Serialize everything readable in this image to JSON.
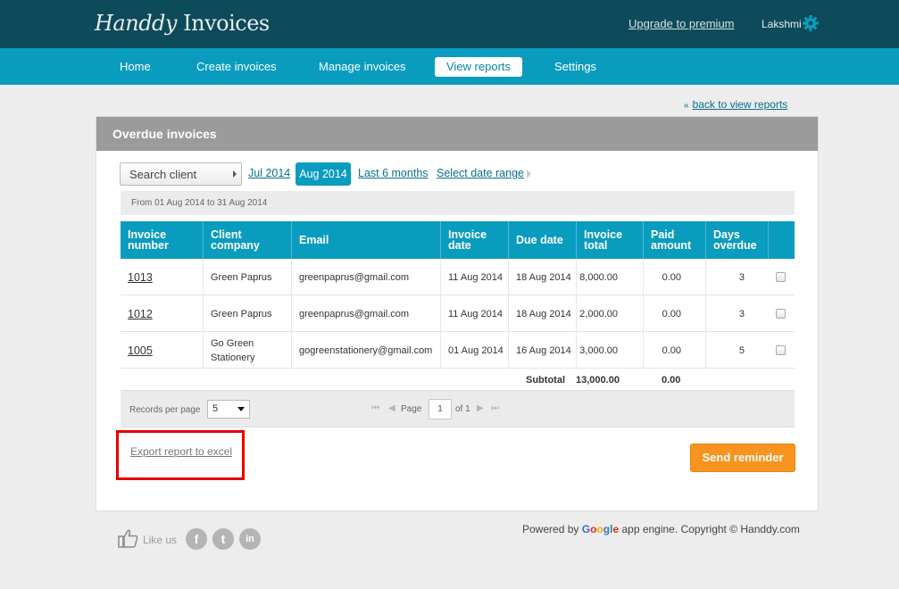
{
  "header": {
    "logo_part1": "Handdy",
    "logo_part2": "Invoices",
    "upgrade_link": "Upgrade to premium",
    "username": "Lakshmi"
  },
  "nav": {
    "items": [
      "Home",
      "Create invoices",
      "Manage invoices",
      "View reports",
      "Settings"
    ],
    "active": "View reports"
  },
  "back_link": "back to view reports",
  "panel": {
    "title": "Overdue invoices",
    "search_client": "Search client",
    "filters": {
      "jul": "Jul 2014",
      "aug": "Aug 2014",
      "last6": "Last 6 months",
      "range": "Select date range"
    },
    "date_range_text": "From 01 Aug 2014 to 31 Aug 2014"
  },
  "table": {
    "headers": {
      "invoice_number": "Invoice number",
      "client_company": "Client company",
      "email": "Email",
      "invoice_date": "Invoice date",
      "due_date": "Due date",
      "invoice_total": "Invoice total",
      "paid_amount": "Paid amount",
      "days_overdue": "Days overdue"
    },
    "rows": [
      {
        "number": "1013",
        "client": "Green Paprus",
        "email": "greenpaprus@gmail.com",
        "invoice_date": "11 Aug 2014",
        "due_date": "18 Aug 2014",
        "total": "8,000.00",
        "paid": "0.00",
        "days": "3"
      },
      {
        "number": "1012",
        "client": "Green Paprus",
        "email": "greenpaprus@gmail.com",
        "invoice_date": "11 Aug 2014",
        "due_date": "18 Aug 2014",
        "total": "2,000.00",
        "paid": "0.00",
        "days": "3"
      },
      {
        "number": "1005",
        "client": "Go Green Stationery",
        "email": "gogreenstationery@gmail.com",
        "invoice_date": "01 Aug 2014",
        "due_date": "16 Aug 2014",
        "total": "3,000.00",
        "paid": "0.00",
        "days": "5"
      }
    ],
    "subtotal_label": "Subtotal",
    "subtotal_total": "13,000.00",
    "subtotal_paid": "0.00"
  },
  "pager": {
    "records_label": "Records per page",
    "records_value": "5",
    "page_label": "Page",
    "page_value": "1",
    "of_label": "of 1"
  },
  "actions": {
    "export": "Export report to excel",
    "send": "Send reminder"
  },
  "footer": {
    "like": "Like us",
    "powered_by": "Powered by",
    "google": "Google",
    "rest": "app engine. Copyright © Handdy.com",
    "social": [
      "f",
      "t",
      "in"
    ]
  },
  "colors": {
    "header_dark": "#0d4a5a",
    "nav_blue": "#0a9cbf",
    "accent_orange": "#f7931e",
    "highlight_red": "#e60000"
  },
  "icons": [
    "gear-icon",
    "like-icon",
    "facebook-icon",
    "twitter-icon",
    "linkedin-icon",
    "first-page-icon",
    "prev-page-icon",
    "next-page-icon",
    "last-page-icon"
  ]
}
